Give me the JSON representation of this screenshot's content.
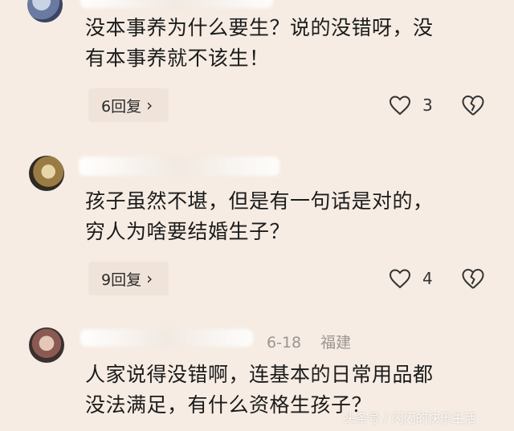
{
  "comments": [
    {
      "text_line1": "没本事养为什么要生？说的没错呀，没",
      "text_line2": "有本事养就不该生！",
      "reply_label": "6回复",
      "likes": "3"
    },
    {
      "text_line1": "孩子虽然不堪，但是有一句话是对的，",
      "text_line2": "穷人为啥要结婚生子？",
      "reply_label": "9回复",
      "likes": "4"
    },
    {
      "date": "6-18",
      "location": "福建",
      "text_line1": "人家说得没错啊，连基本的日常用品都",
      "text_line2": "没法满足，有什么资格生孩子？"
    }
  ],
  "watermark": "头条号 / 闪闪的快乐生活",
  "icons": {
    "chevron": "›",
    "like": "heart-outline-icon",
    "dislike": "broken-heart-icon"
  }
}
